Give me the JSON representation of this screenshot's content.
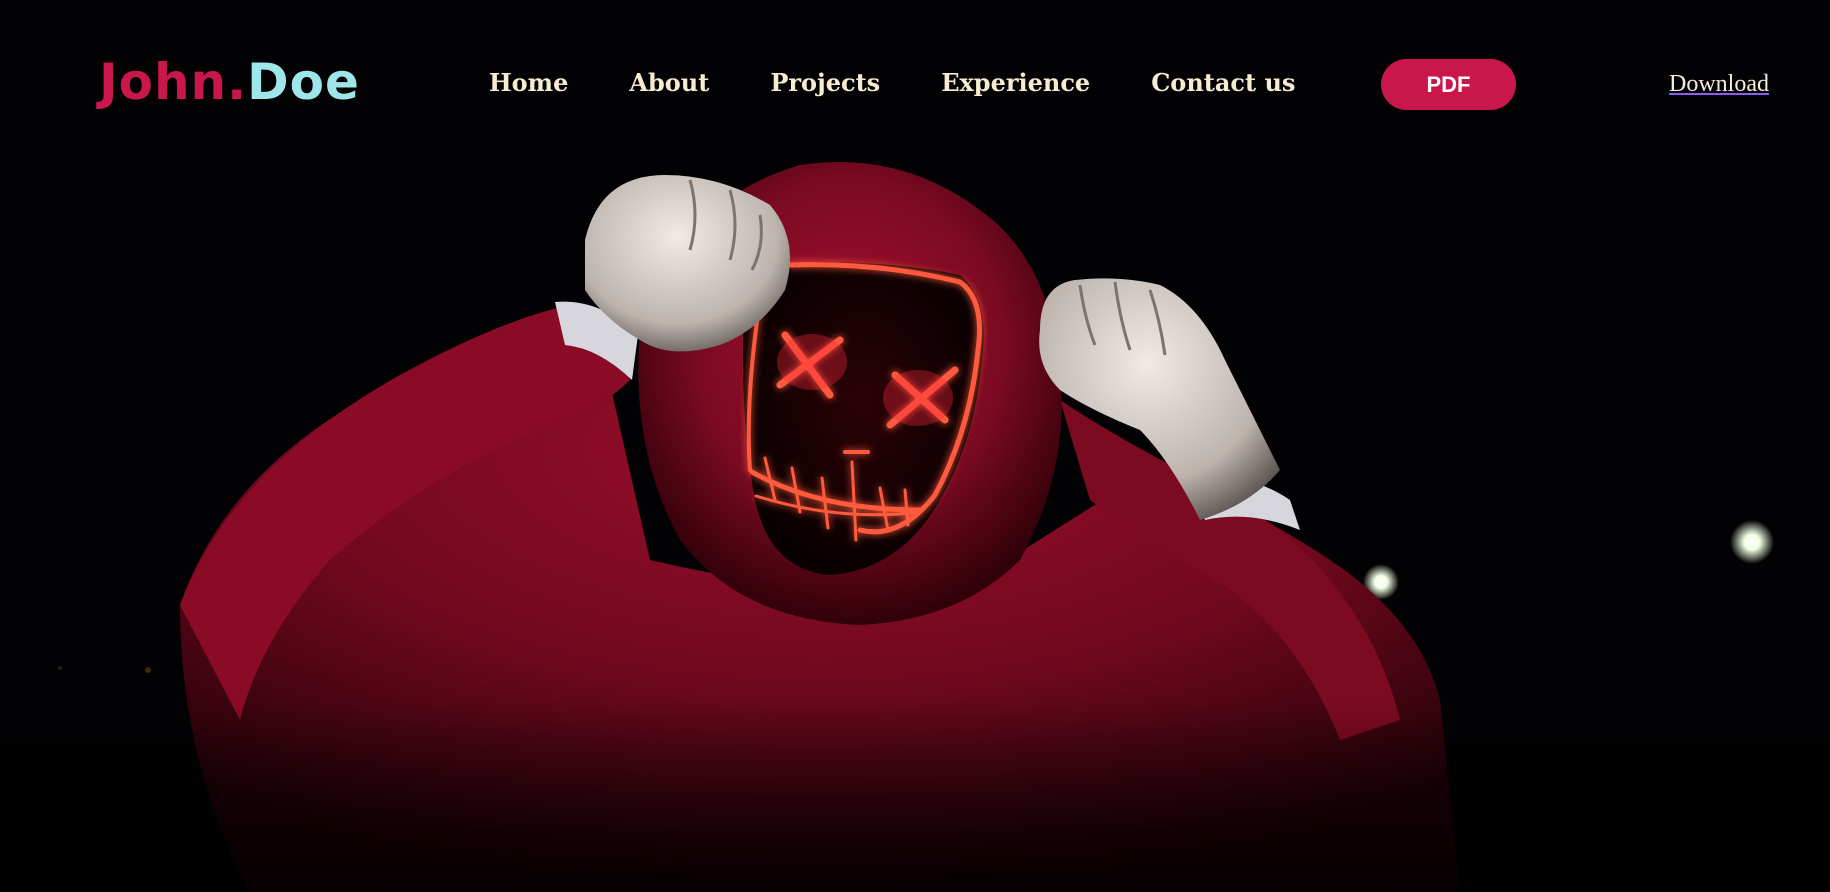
{
  "brand": {
    "first": "John",
    "dot": ".",
    "last": "Doe"
  },
  "nav": {
    "items": [
      {
        "label": "Home"
      },
      {
        "label": "About"
      },
      {
        "label": "Projects"
      },
      {
        "label": "Experience"
      },
      {
        "label": "Contact us"
      }
    ]
  },
  "actions": {
    "pdf_label": "PDF",
    "download_label": "Download"
  },
  "hero": {
    "image_subject": "person-in-red-hoodie-with-neon-mask",
    "colors": {
      "background": "#000000",
      "hoodie": "#8e0c27",
      "neon": "#ff5a3c"
    }
  },
  "colors": {
    "accent": "#c9174b",
    "brand_secondary": "#9ee6ea",
    "nav_text": "#f6ecd0"
  }
}
